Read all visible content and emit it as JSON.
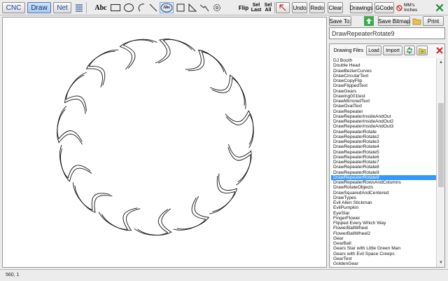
{
  "toolbar": {
    "tabs": [
      {
        "label": "CNC",
        "active": false
      },
      {
        "label": "Draw",
        "active": true
      },
      {
        "label": "Net",
        "active": false
      }
    ],
    "abc_label": "Abc",
    "abc_circle_label": "Abc",
    "flip_label": "Flip",
    "sel_last_line1": "Sel",
    "sel_last_line2": "Last",
    "sel_all_line1": "Sel",
    "sel_all_line2": "All",
    "undo_label": "Undo",
    "redo_label": "Redo",
    "clear_label": "Clear",
    "drawings_label": "Drawings",
    "gcode_label": "GCode",
    "units_line1": "MM's",
    "units_line2": "Inches"
  },
  "panel": {
    "save_to_label": "Save To:",
    "save_bitmap_label": "Save Bitmap",
    "print_label": "Print",
    "current_file": "DrawRepeaterRotate9",
    "files_title": "Drawing Files",
    "load_label": "Load",
    "import_label": "Import",
    "selected_index": 23,
    "files": [
      "DJ Booth",
      "Double Head",
      "DrawBezierCurves",
      "DrawCircularText",
      "DrawCopyFlip",
      "DrawFlippedText",
      "DrawGears",
      "Drawing001test",
      "DrawMirroredText",
      "DrawOvalText",
      "DrawRepeater",
      "DrawRepeaterInsideAndOut",
      "DrawRepeaterInsideAndOut2",
      "DrawRepeaterInsideAndOut3",
      "DrawRepeaterRotate",
      "DrawRepeaterRotate2",
      "DrawRepeaterRotate3",
      "DrawRepeaterRotate4",
      "DrawRepeaterRotate5",
      "DrawRepeaterRotate6",
      "DrawRepeaterRotate7",
      "DrawRepeaterRotate8",
      "DrawRepeaterRotate9",
      "DrawRepeaterRotate9",
      "DrawRepeaterRowsAndColumns",
      "DrawRotateObjects",
      "DrawSquaredAndCentered",
      "DrawTypes",
      "Evil Alien Stickman",
      "EvilPumpkin",
      "EyeStar",
      "FingerFlower",
      "Flipped Every Which Way",
      "FlowerBallWheel",
      "FlowerBallWheel2",
      "Gear",
      "GearBall",
      "Gears Star with Little Green Man",
      "Gears with Evil Space Creeps",
      "GearTest",
      "GoldenGear"
    ]
  },
  "status": {
    "coords": "560, 1"
  },
  "colors": {
    "selection": "#3399ff",
    "save_arrow": "#22a33a",
    "delete_x": "#d42020",
    "units_circle": "#cc2222"
  }
}
